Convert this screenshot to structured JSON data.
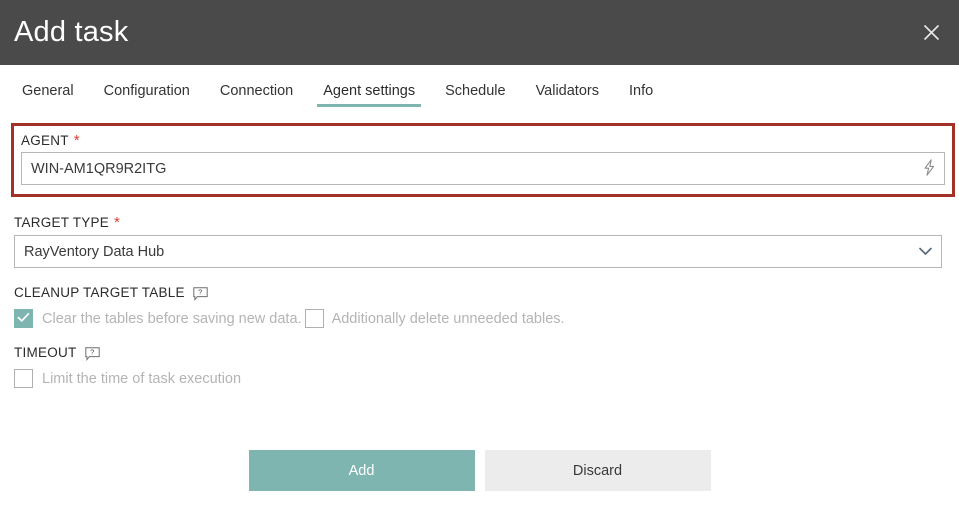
{
  "dialog": {
    "title": "Add task",
    "close_icon": "close-icon"
  },
  "tabs": [
    {
      "label": "General",
      "active": false
    },
    {
      "label": "Configuration",
      "active": false
    },
    {
      "label": "Connection",
      "active": false
    },
    {
      "label": "Agent settings",
      "active": true
    },
    {
      "label": "Schedule",
      "active": false
    },
    {
      "label": "Validators",
      "active": false
    },
    {
      "label": "Info",
      "active": false
    }
  ],
  "fields": {
    "agent": {
      "label": "AGENT",
      "required_marker": "*",
      "value": "WIN-AM1QR9R2ITG",
      "placeholder": "",
      "action_icon": "lightning-bolt-icon",
      "invalid": true
    },
    "target_type": {
      "label": "TARGET TYPE",
      "required_marker": "*",
      "value": "RayVentory Data Hub",
      "chevron_icon": "chevron-down-icon"
    },
    "cleanup_target_table": {
      "label": "CLEANUP TARGET TABLE",
      "help_icon": "help-tooltip-icon",
      "clear_tables": {
        "label": "Clear the tables before saving new data.",
        "checked": true,
        "disabled": true
      },
      "delete_unneeded": {
        "label": "Additionally delete unneeded tables.",
        "checked": false,
        "disabled": true
      }
    },
    "timeout": {
      "label": "TIMEOUT",
      "help_icon": "help-tooltip-icon",
      "limit_time": {
        "label": "Limit the time of task execution",
        "checked": false,
        "disabled": true
      }
    }
  },
  "footer": {
    "add_label": "Add",
    "discard_label": "Discard"
  },
  "colors": {
    "header_bg": "#4a4a4a",
    "accent_teal": "#7fb5b0",
    "error_red": "#a33129",
    "required_star": "#e23b2e",
    "secondary_btn": "#ececec"
  }
}
